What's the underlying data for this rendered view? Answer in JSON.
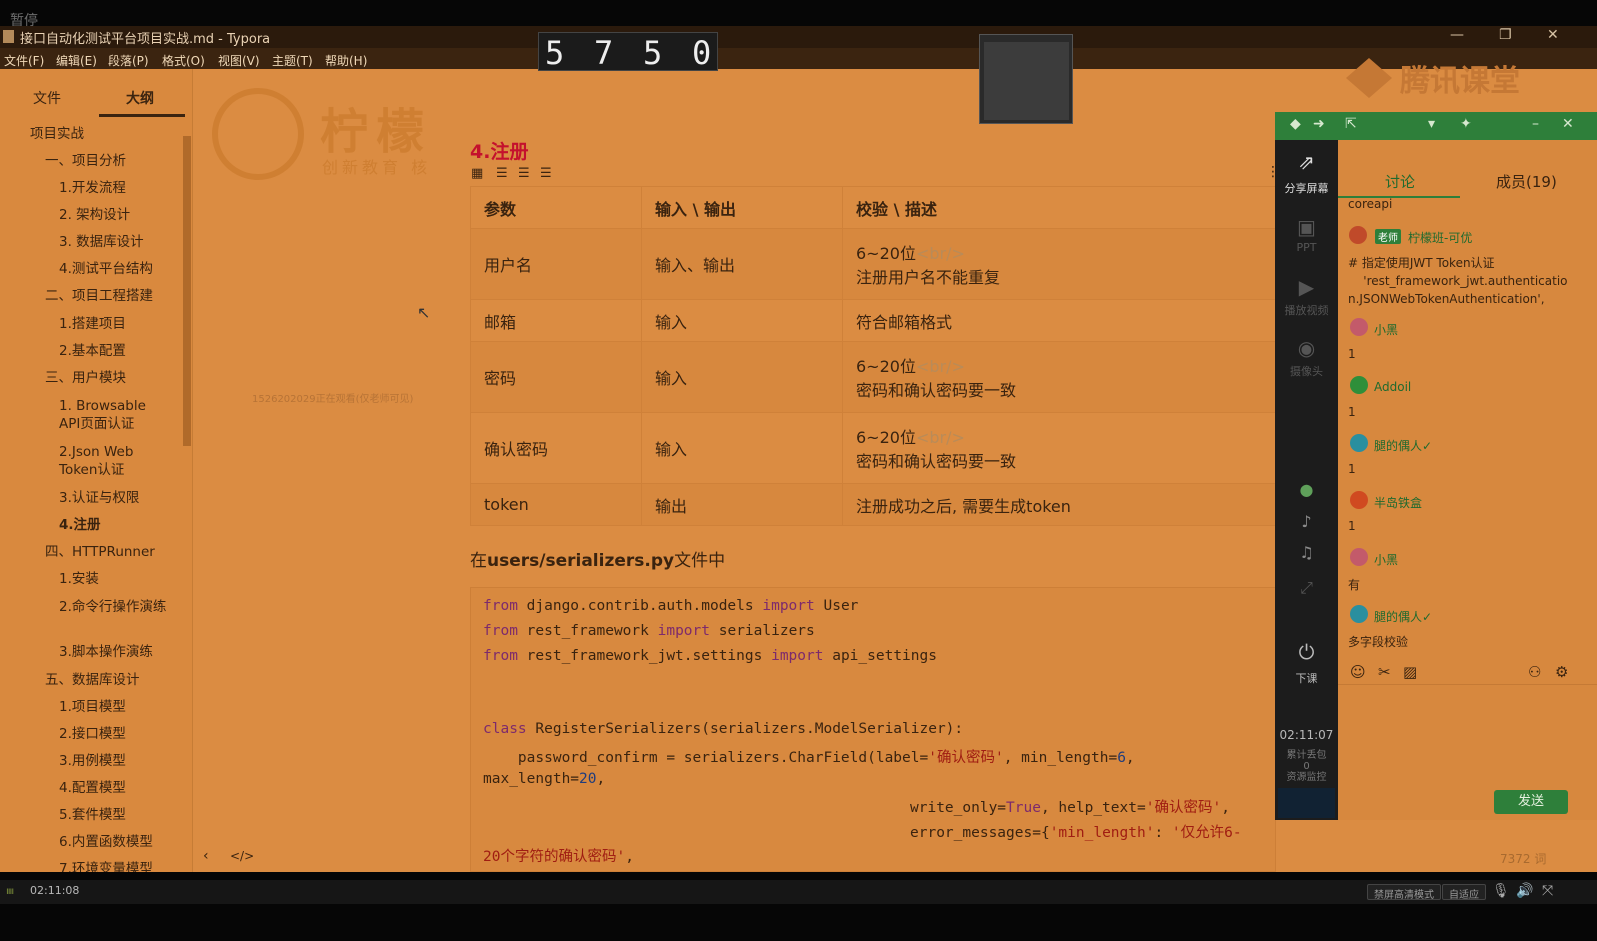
{
  "video": {
    "paused_label": "暂停",
    "current_time": "02:11:08",
    "buttons": [
      "禁屏高清模式",
      "自适应"
    ]
  },
  "window": {
    "title": "接口自动化测试平台项目实战.md - Typora",
    "controls": [
      "minimize-icon",
      "restore-icon",
      "close-icon"
    ]
  },
  "menu": [
    "文件(F)",
    "编辑(E)",
    "段落(P)",
    "格式(O)",
    "视图(V)",
    "主题(T)",
    "帮助(H)"
  ],
  "sidebar": {
    "tabs": [
      "文件",
      "大纲"
    ],
    "active_tab": "大纲",
    "outline": [
      {
        "text": "项目实战",
        "level": 0
      },
      {
        "text": "一、项目分析",
        "level": 1
      },
      {
        "text": "1.开发流程",
        "level": 2
      },
      {
        "text": "2. 架构设计",
        "level": 2
      },
      {
        "text": "3. 数据库设计",
        "level": 2
      },
      {
        "text": "4.测试平台结构",
        "level": 2
      },
      {
        "text": "二、项目工程搭建",
        "level": 1
      },
      {
        "text": "1.搭建项目",
        "level": 2
      },
      {
        "text": "2.基本配置",
        "level": 2
      },
      {
        "text": "三、用户模块",
        "level": 1
      },
      {
        "text": "1. Browsable API页面认证",
        "level": 2
      },
      {
        "text": "2.Json Web Token认证",
        "level": 2
      },
      {
        "text": "3.认证与权限",
        "level": 2
      },
      {
        "text": "4.注册",
        "level": 2,
        "active": true
      },
      {
        "text": "四、HTTPRunner",
        "level": 1
      },
      {
        "text": "1.安装",
        "level": 2
      },
      {
        "text": "2.命令行操作演练",
        "level": 2
      },
      {
        "text": "3.脚本操作演练",
        "level": 2
      },
      {
        "text": "五、数据库设计",
        "level": 1
      },
      {
        "text": "1.项目模型",
        "level": 2
      },
      {
        "text": "2.接口模型",
        "level": 2
      },
      {
        "text": "3.用例模型",
        "level": 2
      },
      {
        "text": "4.配置模型",
        "level": 2
      },
      {
        "text": "5.套件模型",
        "level": 2
      },
      {
        "text": "6.内置函数模型",
        "level": 2
      },
      {
        "text": "7.环境变量模型",
        "level": 2
      }
    ]
  },
  "editor": {
    "logo_main": "柠檬",
    "logo_sub": "创新教育 核",
    "watermark": "1526202029正在观看(仅老师可见)",
    "heading": "4.注册",
    "table": {
      "headers": [
        "参数",
        "输入 \\ 输出",
        "校验 \\ 描述"
      ],
      "rows": [
        {
          "param": "用户名",
          "io": "输入、输出",
          "desc1": "6~20位",
          "br": "<br/>",
          "desc2": "注册用户名不能重复"
        },
        {
          "param": "邮箱",
          "io": "输入",
          "desc1": "符合邮箱格式",
          "br": "",
          "desc2": ""
        },
        {
          "param": "密码",
          "io": "输入",
          "desc1": "6~20位",
          "br": "<br/>",
          "desc2": "密码和确认密码要一致"
        },
        {
          "param": "确认密码",
          "io": "输入",
          "desc1": "6~20位",
          "br": "<br/>",
          "desc2": "密码和确认密码要一致"
        },
        {
          "param": "token",
          "io": "输出",
          "desc1": "注册成功之后, 需要生成token",
          "br": "",
          "desc2": ""
        }
      ]
    },
    "para_prefix": "在",
    "para_bold": "users/serializers.py",
    "para_suffix": "文件中",
    "code": {
      "l1a": "from",
      "l1b": " django.contrib.auth.models ",
      "l1c": "import",
      "l1d": " User",
      "l2a": "from",
      "l2b": " rest_framework ",
      "l2c": "import",
      "l2d": " serializers",
      "l3a": "from",
      "l3b": " rest_framework_jwt.settings ",
      "l3c": "import",
      "l3d": " api_settings",
      "l4a": "class",
      "l4b": " RegisterSerializers(serializers.ModelSerializer):",
      "l5a": "    password_confirm = serializers.CharField(label=",
      "l5b": "'确认密码'",
      "l5c": ", min_length=",
      "l5d": "6",
      "l5e": ",",
      "l6a": "max_length=",
      "l6b": "20",
      "l6c": ",",
      "l7a": "write_only=",
      "l7b": "True",
      "l7c": ", help_text=",
      "l7d": "'确认密码'",
      "l7e": ",",
      "l8a": "error_messages={",
      "l8b": "'min_length'",
      "l8c": ": ",
      "l8d": "'仅允许6-",
      "l9a": "20个字符的确认密码'",
      "l9b": ","
    },
    "word_count": "7372 词"
  },
  "timer": {
    "digits": [
      "5",
      "7",
      "5",
      "0"
    ]
  },
  "tencent": {
    "brand": "腾讯课堂",
    "side_items": [
      "分享屏幕",
      "PPT",
      "播放视频",
      "摄像头",
      "下课"
    ],
    "clock": "02:11:07",
    "stats1": "累计丢包",
    "stats2": "0",
    "stats3": "资源监控",
    "tabs": [
      "讨论",
      "成员(19)"
    ],
    "messages": [
      {
        "user": "",
        "text": "coreapi"
      },
      {
        "user": "柠檬班-可优",
        "badge": "老师",
        "text": "# 指定使用JWT Token认证\n    'rest_framework_jwt.authentication.JSONWebTokenAuthentication',"
      },
      {
        "user": "小黑",
        "text": "1"
      },
      {
        "user": "Addoil",
        "text": "1"
      },
      {
        "user": "腿的偶人✓",
        "text": "1"
      },
      {
        "user": "半岛铁盒",
        "text": "1"
      },
      {
        "user": "小黑",
        "text": "有"
      },
      {
        "user": "腿的偶人✓",
        "text": "多字段校验"
      }
    ],
    "send_label": "发送"
  }
}
